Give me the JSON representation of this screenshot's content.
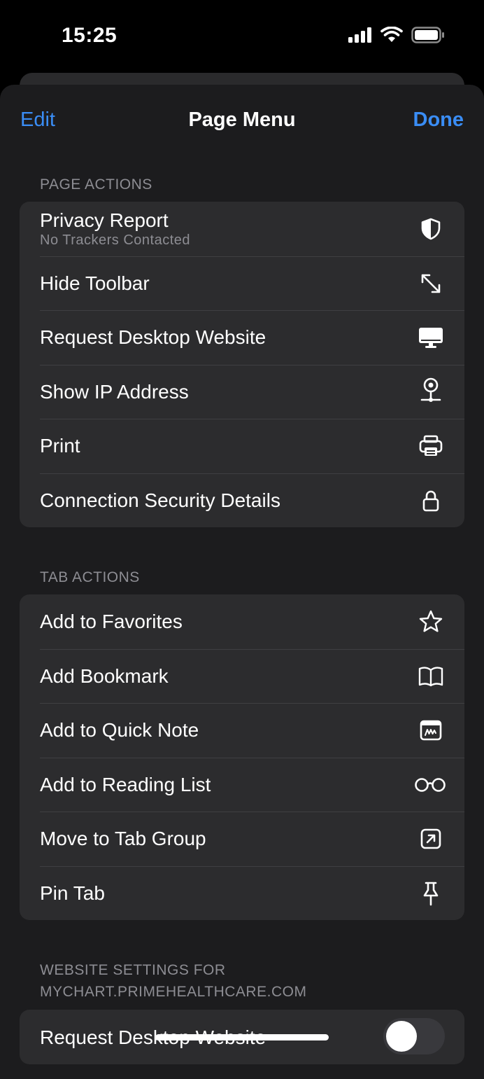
{
  "status": {
    "time": "15:25"
  },
  "nav": {
    "edit_label": "Edit",
    "title": "Page Menu",
    "done_label": "Done"
  },
  "page_actions": {
    "header": "PAGE ACTIONS",
    "items": [
      {
        "label": "Privacy Report",
        "sublabel": "No Trackers Contacted",
        "icon": "shield-icon"
      },
      {
        "label": "Hide Toolbar",
        "icon": "expand-arrows-icon"
      },
      {
        "label": "Request Desktop Website",
        "icon": "desktop-icon"
      },
      {
        "label": "Show IP Address",
        "icon": "location-pin-icon"
      },
      {
        "label": "Print",
        "icon": "printer-icon"
      },
      {
        "label": "Connection Security Details",
        "icon": "lock-icon"
      }
    ]
  },
  "tab_actions": {
    "header": "TAB ACTIONS",
    "items": [
      {
        "label": "Add to Favorites",
        "icon": "star-icon"
      },
      {
        "label": "Add Bookmark",
        "icon": "book-icon"
      },
      {
        "label": "Add to Quick Note",
        "icon": "quick-note-icon"
      },
      {
        "label": "Add to Reading List",
        "icon": "glasses-icon"
      },
      {
        "label": "Move to Tab Group",
        "icon": "tab-group-icon"
      },
      {
        "label": "Pin Tab",
        "icon": "pin-icon"
      }
    ]
  },
  "website_settings": {
    "header_line1": "WEBSITE SETTINGS FOR",
    "header_line2": "MYCHART.PRIMEHEALTHCARE.COM",
    "items": [
      {
        "label": "Request Desktop Website",
        "toggle_on": false
      }
    ]
  },
  "colors": {
    "accent": "#3a8df5",
    "sheet": "#1c1c1e",
    "group": "#2c2c2e",
    "secondary_text": "#8d8d93"
  }
}
